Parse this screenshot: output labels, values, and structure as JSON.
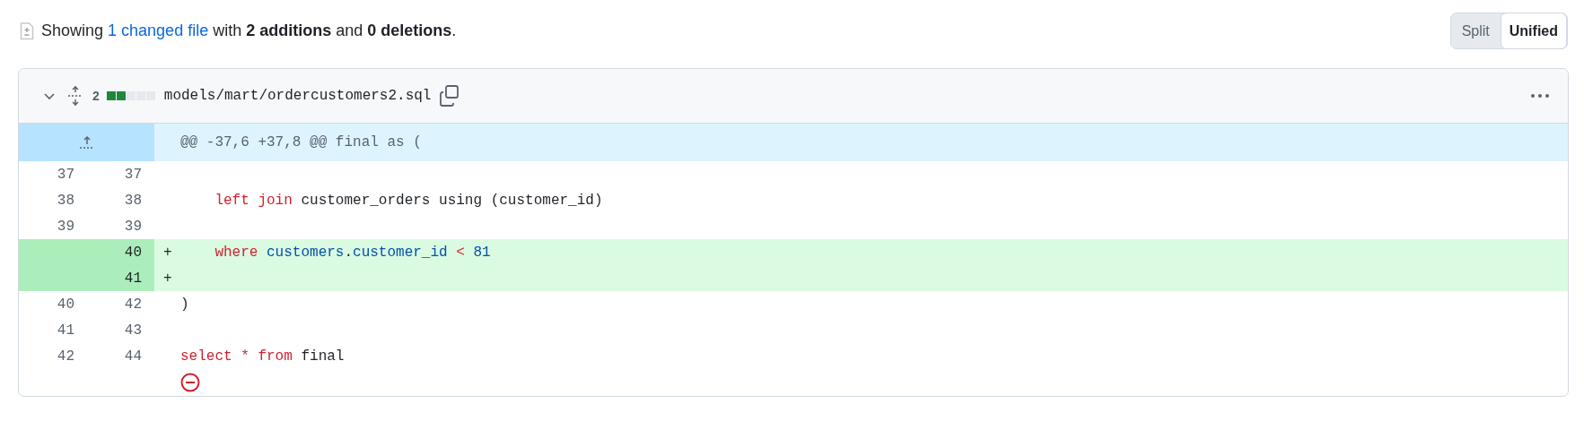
{
  "summary": {
    "prefix": "Showing",
    "link": "1 changed file",
    "middle": "with",
    "additions": "2 additions",
    "conjunction": "and",
    "deletions": "0 deletions",
    "end": "."
  },
  "view_toggle": [
    {
      "label": "Split",
      "selected": false
    },
    {
      "label": "Unified",
      "selected": true
    }
  ],
  "file": {
    "expanded": true,
    "change_count": "2",
    "diffstat": [
      {
        "kind": "added"
      },
      {
        "kind": "added"
      },
      {
        "kind": "neutral"
      },
      {
        "kind": "neutral"
      },
      {
        "kind": "neutral"
      }
    ],
    "path": "models/mart/ordercustomers2.sql"
  },
  "hunk_header": "@@ -37,6 +37,8 @@ final as (",
  "lines": [
    {
      "kind": "context",
      "old": "37",
      "new": "37"
    },
    {
      "kind": "context",
      "old": "38",
      "new": "38",
      "code": [
        {
          "kind": "keyword",
          "text": "    left join"
        },
        {
          "kind": "plain",
          "text": " customer_orders using (customer_id)"
        }
      ]
    },
    {
      "kind": "context",
      "old": "39",
      "new": "39"
    },
    {
      "kind": "addition",
      "new": "40",
      "marker": "+",
      "code": [
        {
          "kind": "keyword",
          "text": "    where "
        },
        {
          "kind": "entity",
          "text": "customers"
        },
        {
          "kind": "plain",
          "text": "."
        },
        {
          "kind": "entity",
          "text": "customer_id "
        },
        {
          "kind": "keyword",
          "text": "< "
        },
        {
          "kind": "entity",
          "text": "81"
        }
      ]
    },
    {
      "kind": "addition",
      "new": "41",
      "marker": "+"
    },
    {
      "kind": "context",
      "old": "40",
      "new": "42",
      "code": [
        {
          "kind": "plain",
          "text": ")"
        }
      ]
    },
    {
      "kind": "context",
      "old": "41",
      "new": "43"
    },
    {
      "kind": "context",
      "old": "42",
      "new": "44",
      "code": [
        {
          "kind": "keyword",
          "text": "select * from"
        },
        {
          "kind": "plain",
          "text": " final"
        }
      ]
    }
  ],
  "no_newline_at_end": true
}
